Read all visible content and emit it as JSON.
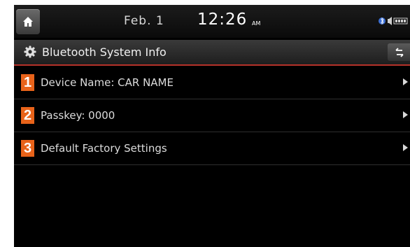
{
  "status_bar": {
    "date": "Feb.  1",
    "time": "12:26",
    "ampm": "AM",
    "home_icon": "home-icon",
    "status_icons": [
      "bluetooth-icon",
      "audio-icon",
      "battery-icon"
    ]
  },
  "title_bar": {
    "title": "Bluetooth System Info",
    "icon": "gear-icon",
    "back_icon": "back-icon"
  },
  "menu": {
    "items": [
      {
        "number": "1",
        "label": "Device Name: CAR NAME"
      },
      {
        "number": "2",
        "label": "Passkey: 0000"
      },
      {
        "number": "3",
        "label": "Default Factory Settings"
      }
    ]
  },
  "colors": {
    "accent": "#b5322a",
    "badge": "#e8631a",
    "background": "#000000"
  }
}
